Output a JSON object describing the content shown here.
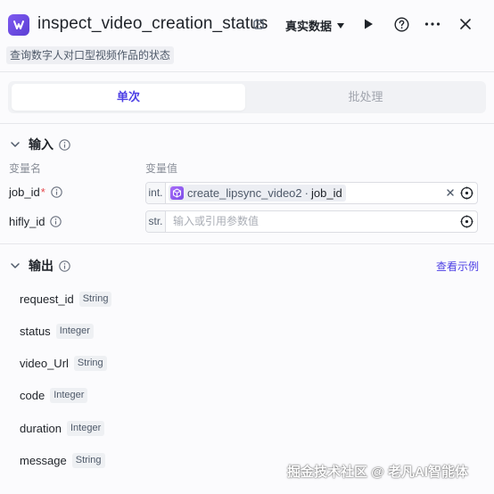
{
  "header": {
    "title": "inspect_video_creation_status",
    "data_mode": "真实数据",
    "subtitle": "查询数字人对口型视频作品的状态"
  },
  "tabs": [
    {
      "label": "单次",
      "active": true
    },
    {
      "label": "批处理",
      "active": false
    }
  ],
  "input": {
    "section_title": "输入",
    "col_name_label": "变量名",
    "col_value_label": "变量值",
    "rows": [
      {
        "name": "job_id",
        "required": true,
        "type": "int.",
        "ref_node": "create_lipsync_video2",
        "ref_sep": "·",
        "ref_var": "job_id"
      },
      {
        "name": "hifly_id",
        "required": false,
        "type": "str.",
        "placeholder": "输入或引用参数值"
      }
    ]
  },
  "output": {
    "section_title": "输出",
    "view_example": "查看示例",
    "fields": [
      {
        "name": "request_id",
        "type": "String"
      },
      {
        "name": "status",
        "type": "Integer"
      },
      {
        "name": "video_Url",
        "type": "String"
      },
      {
        "name": "code",
        "type": "Integer"
      },
      {
        "name": "duration",
        "type": "Integer"
      },
      {
        "name": "message",
        "type": "String"
      }
    ]
  },
  "watermark": "掘金技术社区 @ 老凡AI智能体",
  "colors": {
    "accent": "#4e40e5",
    "icon_purple": "#7f5af0",
    "required": "#e5484d"
  }
}
